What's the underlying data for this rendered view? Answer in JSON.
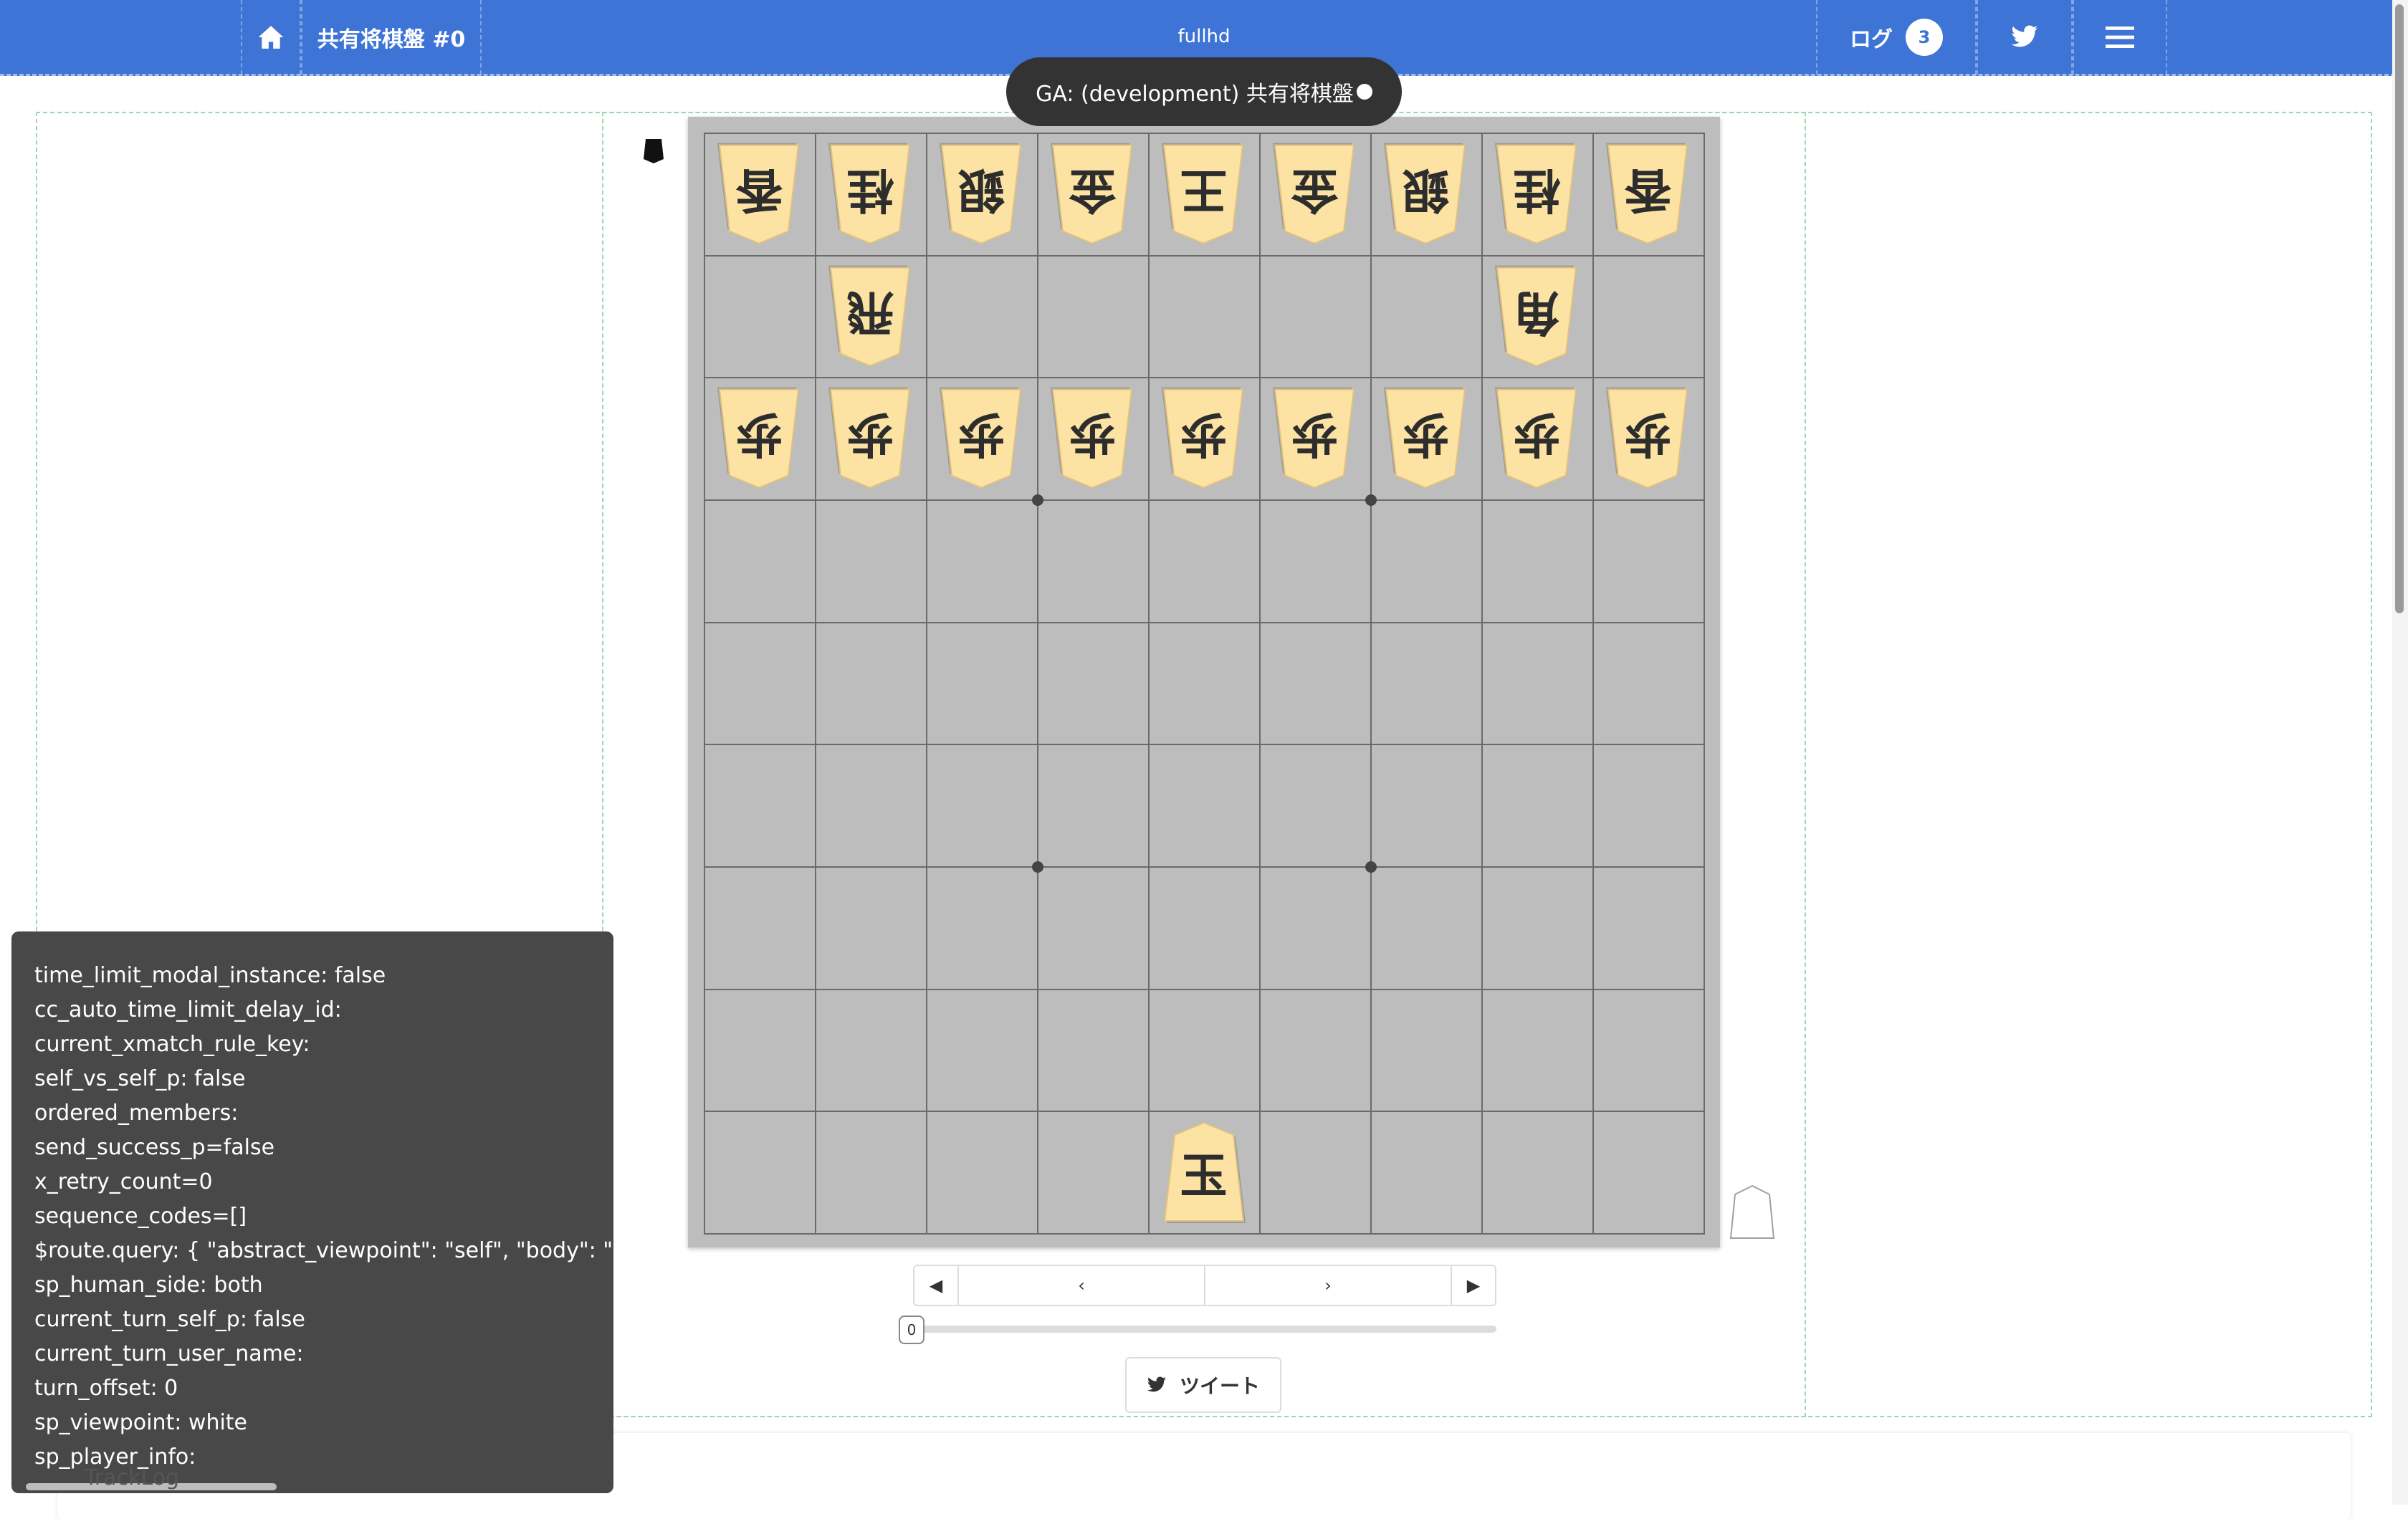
{
  "navbar": {
    "title": "共有将棋盤 #0",
    "center_label": "fullhd",
    "log_label": "ログ",
    "log_count": "3"
  },
  "toast": {
    "text": "GA: (development) 共有将棋盤"
  },
  "board": {
    "files": 9,
    "ranks": 9,
    "pieces": [
      {
        "rank": 1,
        "file": 9,
        "kanji": "香",
        "side": "gote"
      },
      {
        "rank": 1,
        "file": 8,
        "kanji": "桂",
        "side": "gote"
      },
      {
        "rank": 1,
        "file": 7,
        "kanji": "銀",
        "side": "gote"
      },
      {
        "rank": 1,
        "file": 6,
        "kanji": "金",
        "side": "gote"
      },
      {
        "rank": 1,
        "file": 5,
        "kanji": "王",
        "side": "gote"
      },
      {
        "rank": 1,
        "file": 4,
        "kanji": "金",
        "side": "gote"
      },
      {
        "rank": 1,
        "file": 3,
        "kanji": "銀",
        "side": "gote"
      },
      {
        "rank": 1,
        "file": 2,
        "kanji": "桂",
        "side": "gote"
      },
      {
        "rank": 1,
        "file": 1,
        "kanji": "香",
        "side": "gote"
      },
      {
        "rank": 2,
        "file": 8,
        "kanji": "飛",
        "side": "gote"
      },
      {
        "rank": 2,
        "file": 2,
        "kanji": "角",
        "side": "gote"
      },
      {
        "rank": 3,
        "file": 9,
        "kanji": "歩",
        "side": "gote"
      },
      {
        "rank": 3,
        "file": 8,
        "kanji": "歩",
        "side": "gote"
      },
      {
        "rank": 3,
        "file": 7,
        "kanji": "歩",
        "side": "gote"
      },
      {
        "rank": 3,
        "file": 6,
        "kanji": "歩",
        "side": "gote"
      },
      {
        "rank": 3,
        "file": 5,
        "kanji": "歩",
        "side": "gote"
      },
      {
        "rank": 3,
        "file": 4,
        "kanji": "歩",
        "side": "gote"
      },
      {
        "rank": 3,
        "file": 3,
        "kanji": "歩",
        "side": "gote"
      },
      {
        "rank": 3,
        "file": 2,
        "kanji": "歩",
        "side": "gote"
      },
      {
        "rank": 3,
        "file": 1,
        "kanji": "歩",
        "side": "gote"
      },
      {
        "rank": 9,
        "file": 5,
        "kanji": "玉",
        "side": "sente"
      }
    ],
    "star_points": [
      [
        3,
        3
      ],
      [
        3,
        6
      ],
      [
        6,
        3
      ],
      [
        6,
        6
      ]
    ]
  },
  "controls": {
    "first": "◀",
    "prev": "‹",
    "next": "›",
    "last": "▶",
    "turn_value": "0"
  },
  "tweet": {
    "label": "ツイート"
  },
  "debug_lines": [
    "time_limit_modal_instance: false",
    "cc_auto_time_limit_delay_id:",
    "current_xmatch_rule_key:",
    "self_vs_self_p: false",
    "ordered_members:",
    "send_success_p=false",
    "x_retry_count=0",
    "sequence_codes=[]",
    "$route.query: { \"abstract_viewpoint\": \"self\", \"body\": \"pos",
    "sp_human_side: both",
    "current_turn_self_p: false",
    "current_turn_user_name:",
    "turn_offset: 0",
    "sp_viewpoint: white",
    "sp_player_info:"
  ],
  "tracklog_label": "TrackLog",
  "colors": {
    "navbar": "#3d74d6",
    "board": "#bdbdbd",
    "piece_face": "#fce3a4",
    "debug_bg": "#484848"
  },
  "icons": {
    "home": "home-icon",
    "twitter": "twitter-icon",
    "menu": "hamburger-icon"
  }
}
